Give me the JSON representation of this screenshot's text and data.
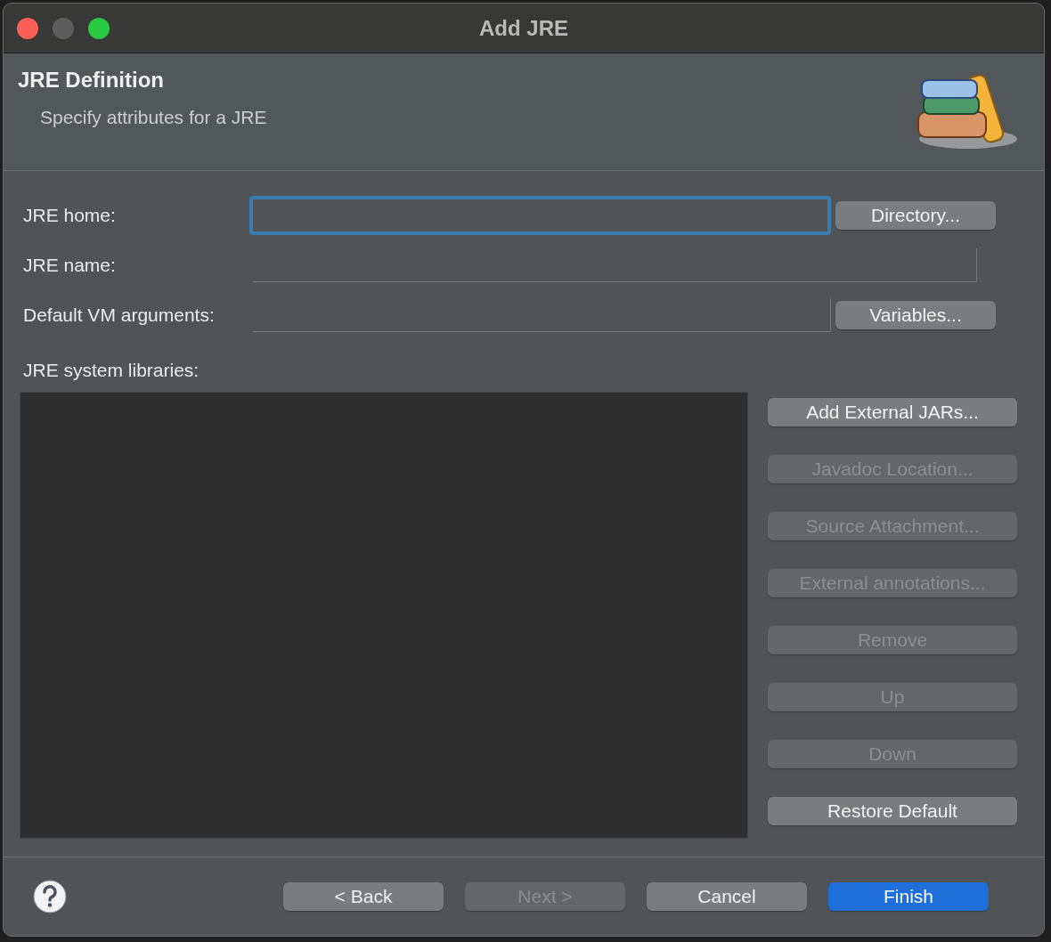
{
  "window": {
    "title": "Add JRE"
  },
  "header": {
    "title": "JRE Definition",
    "subtitle": "Specify attributes for a JRE"
  },
  "fields": [
    {
      "label": "JRE home:",
      "focused": true,
      "button": "Directory..."
    },
    {
      "label": "JRE name:",
      "focused": false
    },
    {
      "label": "Default VM arguments:",
      "focused": false,
      "button": "Variables..."
    }
  ],
  "libraries": {
    "label": "JRE system libraries:",
    "buttons": [
      {
        "label": "Add External JARs...",
        "disabled": false
      },
      {
        "label": "Javadoc Location...",
        "disabled": true
      },
      {
        "label": "Source Attachment...",
        "disabled": true
      },
      {
        "label": "External annotations...",
        "disabled": true
      },
      {
        "label": "Remove",
        "disabled": true
      },
      {
        "label": "Up",
        "disabled": true
      },
      {
        "label": "Down",
        "disabled": true
      },
      {
        "label": "Restore Default",
        "disabled": false
      }
    ]
  },
  "footer": {
    "buttons": [
      {
        "label": "< Back",
        "disabled": false,
        "default": false
      },
      {
        "label": "Next >",
        "disabled": true,
        "default": false
      },
      {
        "label": "Cancel",
        "disabled": false,
        "default": false
      },
      {
        "label": "Finish",
        "disabled": false,
        "default": true
      }
    ]
  }
}
